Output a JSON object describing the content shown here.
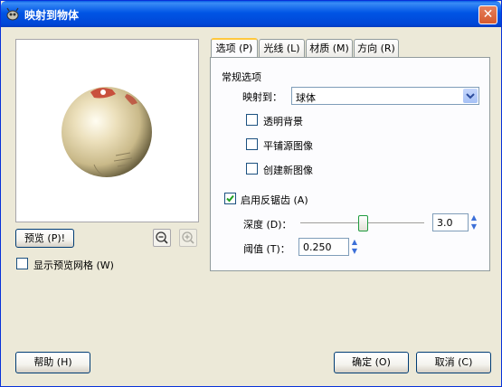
{
  "window": {
    "title": "映射到物体"
  },
  "preview": {
    "button_label": "预览 (P)!",
    "show_grid_label": "显示预览网格 (W)",
    "zoom_in_icon": "zoom-in-icon",
    "zoom_out_icon": "zoom-out-icon"
  },
  "tabs": [
    {
      "label": "选项 (P)"
    },
    {
      "label": "光线 (L)"
    },
    {
      "label": "材质 (M)"
    },
    {
      "label": "方向 (R)"
    }
  ],
  "options": {
    "section_title": "常规选项",
    "map_to_label": "映射到：",
    "map_to_value": "球体",
    "transparent_bg_label": "透明背景",
    "tile_source_label": "平铺源图像",
    "create_new_label": "创建新图像",
    "antialias_label": "启用反锯齿 (A)",
    "antialias_checked": true,
    "depth_label": "深度 (D)：",
    "depth_value": "3.0",
    "depth_fraction": 0.45,
    "threshold_label": "阈值 (T)：",
    "threshold_value": "0.250"
  },
  "footer": {
    "help_label": "帮助 (H)",
    "ok_label": "确定 (O)",
    "cancel_label": "取消 (C)"
  }
}
